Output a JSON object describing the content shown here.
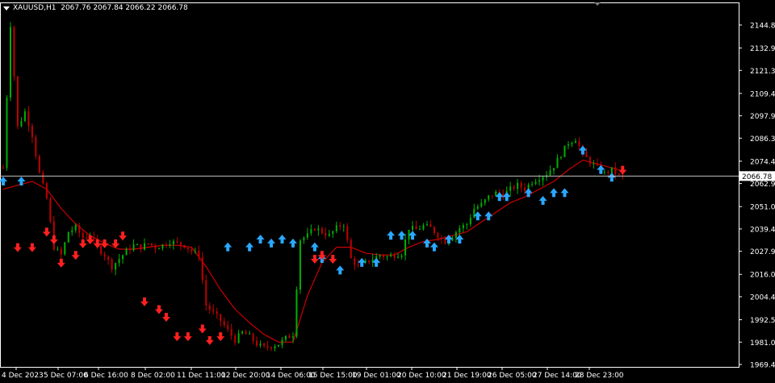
{
  "header": {
    "symbol": "XAUUSD,H1",
    "open": "2067.76",
    "high": "2067.84",
    "low": "2066.22",
    "close": "2066.78"
  },
  "colors": {
    "background": "#000000",
    "frame": "#ffffff",
    "bull": "#00b000",
    "bear": "#c00000",
    "ma": "#cc0000",
    "up_arrow": "#2aa8ff",
    "down_arrow": "#ff2020",
    "price_line": "#c0c0c0"
  },
  "chart_data": {
    "type": "candlestick",
    "y_ticks": [
      "2144.80",
      "2132.90",
      "2121.35",
      "2109.45",
      "2097.90",
      "2086.35",
      "2074.45",
      "2062.90",
      "2051.00",
      "2039.45",
      "2027.90",
      "2016.00",
      "2004.45",
      "1992.55",
      "1981.00",
      "1969.45"
    ],
    "x_ticks": [
      "4 Dec 2023",
      "5 Dec 07:00",
      "6 Dec 16:00",
      "8 Dec 02:00",
      "11 Dec 11:00",
      "12 Dec 20:00",
      "14 Dec 06:00",
      "15 Dec 15:00",
      "19 Dec 01:00",
      "20 Dec 10:00",
      "21 Dec 19:00",
      "26 Dec 05:00",
      "27 Dec 14:00",
      "28 Dec 23:00"
    ],
    "ylim": [
      1966.0,
      2150.0
    ],
    "current_price": "2066.78",
    "current_price_value": 2066.78,
    "close_path": [
      [
        0,
        2071
      ],
      [
        2,
        2145
      ],
      [
        4,
        2092
      ],
      [
        6,
        2100
      ],
      [
        8,
        2088
      ],
      [
        10,
        2068
      ],
      [
        12,
        2055
      ],
      [
        14,
        2030
      ],
      [
        16,
        2026
      ],
      [
        18,
        2038
      ],
      [
        20,
        2040
      ],
      [
        22,
        2035
      ],
      [
        24,
        2036
      ],
      [
        26,
        2030
      ],
      [
        28,
        2026
      ],
      [
        30,
        2020
      ],
      [
        32,
        2024
      ],
      [
        34,
        2028
      ],
      [
        36,
        2031
      ],
      [
        38,
        2030
      ],
      [
        40,
        2032
      ],
      [
        42,
        2030
      ],
      [
        44,
        2031
      ],
      [
        46,
        2033
      ],
      [
        48,
        2032
      ],
      [
        50,
        2031
      ],
      [
        52,
        2028
      ],
      [
        54,
        2026
      ],
      [
        56,
        2000
      ],
      [
        58,
        1996
      ],
      [
        60,
        1992
      ],
      [
        62,
        1987
      ],
      [
        64,
        1982
      ],
      [
        66,
        1986
      ],
      [
        68,
        1984
      ],
      [
        70,
        1980
      ],
      [
        72,
        1978
      ],
      [
        74,
        1979
      ],
      [
        76,
        1980
      ],
      [
        78,
        1983
      ],
      [
        80,
        1985
      ],
      [
        82,
        2034
      ],
      [
        84,
        2036
      ],
      [
        86,
        2040
      ],
      [
        88,
        2038
      ],
      [
        90,
        2036
      ],
      [
        92,
        2040
      ],
      [
        94,
        2042
      ],
      [
        96,
        2024
      ],
      [
        98,
        2020
      ],
      [
        100,
        2022
      ],
      [
        102,
        2024
      ],
      [
        104,
        2026
      ],
      [
        106,
        2025
      ],
      [
        108,
        2026
      ],
      [
        110,
        2027
      ],
      [
        112,
        2040
      ],
      [
        114,
        2039
      ],
      [
        116,
        2041
      ],
      [
        118,
        2040
      ],
      [
        120,
        2036
      ],
      [
        122,
        2033
      ],
      [
        124,
        2036
      ],
      [
        126,
        2040
      ],
      [
        128,
        2042
      ],
      [
        130,
        2050
      ],
      [
        132,
        2052
      ],
      [
        134,
        2056
      ],
      [
        136,
        2058
      ],
      [
        138,
        2057
      ],
      [
        140,
        2060
      ],
      [
        142,
        2062
      ],
      [
        144,
        2060
      ],
      [
        146,
        2064
      ],
      [
        148,
        2066
      ],
      [
        150,
        2068
      ],
      [
        152,
        2072
      ],
      [
        154,
        2078
      ],
      [
        156,
        2084
      ],
      [
        158,
        2086
      ],
      [
        160,
        2078
      ],
      [
        162,
        2074
      ],
      [
        164,
        2071
      ],
      [
        166,
        2068
      ],
      [
        168,
        2070
      ],
      [
        170,
        2066.78
      ]
    ],
    "moving_average": [
      [
        0,
        2060
      ],
      [
        4,
        2062
      ],
      [
        8,
        2064
      ],
      [
        12,
        2060
      ],
      [
        16,
        2050
      ],
      [
        20,
        2042
      ],
      [
        24,
        2036
      ],
      [
        28,
        2032
      ],
      [
        32,
        2029
      ],
      [
        36,
        2029
      ],
      [
        40,
        2030
      ],
      [
        44,
        2031
      ],
      [
        48,
        2031
      ],
      [
        52,
        2030
      ],
      [
        56,
        2020
      ],
      [
        60,
        2008
      ],
      [
        64,
        1998
      ],
      [
        68,
        1991
      ],
      [
        72,
        1985
      ],
      [
        76,
        1981
      ],
      [
        80,
        1981
      ],
      [
        84,
        2005
      ],
      [
        88,
        2022
      ],
      [
        92,
        2030
      ],
      [
        96,
        2030
      ],
      [
        100,
        2027
      ],
      [
        104,
        2026
      ],
      [
        108,
        2026
      ],
      [
        112,
        2030
      ],
      [
        116,
        2033
      ],
      [
        120,
        2034
      ],
      [
        124,
        2036
      ],
      [
        128,
        2038
      ],
      [
        132,
        2043
      ],
      [
        136,
        2048
      ],
      [
        140,
        2053
      ],
      [
        144,
        2056
      ],
      [
        148,
        2060
      ],
      [
        152,
        2064
      ],
      [
        156,
        2070
      ],
      [
        160,
        2075
      ],
      [
        164,
        2073
      ],
      [
        168,
        2071
      ],
      [
        170,
        2070
      ]
    ],
    "up_arrows": [
      [
        0,
        2064
      ],
      [
        5,
        2064
      ],
      [
        62,
        2030
      ],
      [
        68,
        2030
      ],
      [
        71,
        2034
      ],
      [
        74,
        2032
      ],
      [
        77,
        2034
      ],
      [
        80,
        2032
      ],
      [
        86,
        2030
      ],
      [
        88,
        2024
      ],
      [
        93,
        2018
      ],
      [
        99,
        2022
      ],
      [
        103,
        2022
      ],
      [
        107,
        2036
      ],
      [
        110,
        2036
      ],
      [
        113,
        2036
      ],
      [
        117,
        2032
      ],
      [
        119,
        2030
      ],
      [
        123,
        2034
      ],
      [
        126,
        2034
      ],
      [
        131,
        2046
      ],
      [
        134,
        2046
      ],
      [
        137,
        2056
      ],
      [
        139,
        2056
      ],
      [
        145,
        2058
      ],
      [
        149,
        2054
      ],
      [
        152,
        2058
      ],
      [
        155,
        2058
      ],
      [
        160,
        2080
      ],
      [
        165,
        2070
      ],
      [
        168,
        2066
      ]
    ],
    "down_arrows": [
      [
        4,
        2030
      ],
      [
        8,
        2030
      ],
      [
        12,
        2038
      ],
      [
        14,
        2034
      ],
      [
        16,
        2022
      ],
      [
        20,
        2026
      ],
      [
        22,
        2032
      ],
      [
        24,
        2034
      ],
      [
        26,
        2032
      ],
      [
        28,
        2032
      ],
      [
        31,
        2032
      ],
      [
        33,
        2036
      ],
      [
        39,
        2002
      ],
      [
        43,
        1998
      ],
      [
        45,
        1994
      ],
      [
        48,
        1984
      ],
      [
        51,
        1984
      ],
      [
        55,
        1988
      ],
      [
        57,
        1982
      ],
      [
        60,
        1984
      ],
      [
        86,
        2024
      ],
      [
        88,
        2026
      ],
      [
        91,
        2024
      ],
      [
        171,
        2070
      ]
    ],
    "n_bars": 172
  }
}
